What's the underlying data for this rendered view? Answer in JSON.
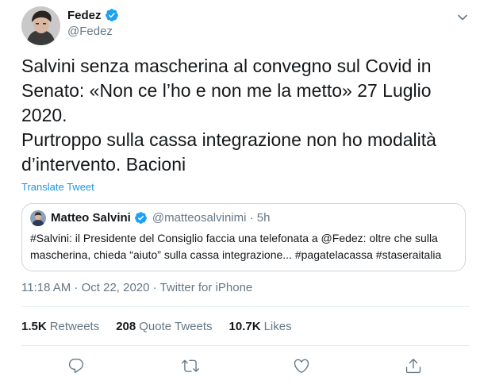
{
  "tweet": {
    "display_name": "Fedez",
    "handle": "@Fedez",
    "verified": true,
    "text_lines": [
      "Salvini senza mascherina al convegno sul Covid in",
      "Senato: «Non ce l’ho e non me la metto» 27 Luglio",
      "2020.",
      "Purtroppo sulla cassa integrazione non ho modalità",
      "d’intervento. Bacioni"
    ],
    "translate_label": "Translate Tweet",
    "timestamp": "11:18 AM · Oct 22, 2020 · Twitter for iPhone"
  },
  "quoted": {
    "display_name": "Matteo Salvini",
    "handle_time": "@matteosalvinimi · 5h",
    "verified": true,
    "text_lines": [
      "#Salvini: il Presidente del Consiglio faccia una telefonata a @Fedez: oltre che sulla",
      "mascherina, chieda “aiuto” sulla cassa integrazione... #pagatelacassa #staseraitalia"
    ]
  },
  "stats": {
    "retweets_count": "1.5K",
    "retweets_label": "Retweets",
    "quotes_count": "208",
    "quotes_label": "Quote Tweets",
    "likes_count": "10.7K",
    "likes_label": "Likes"
  },
  "icons": {
    "verified": "verified-badge-icon",
    "more": "chevron-down-icon",
    "reply": "reply-icon",
    "retweet": "retweet-icon",
    "like": "heart-icon",
    "share": "share-icon"
  },
  "colors": {
    "verified": "#1da1f2",
    "link": "#1b95e0",
    "secondary": "#657786",
    "border": "#ccd6dd"
  }
}
